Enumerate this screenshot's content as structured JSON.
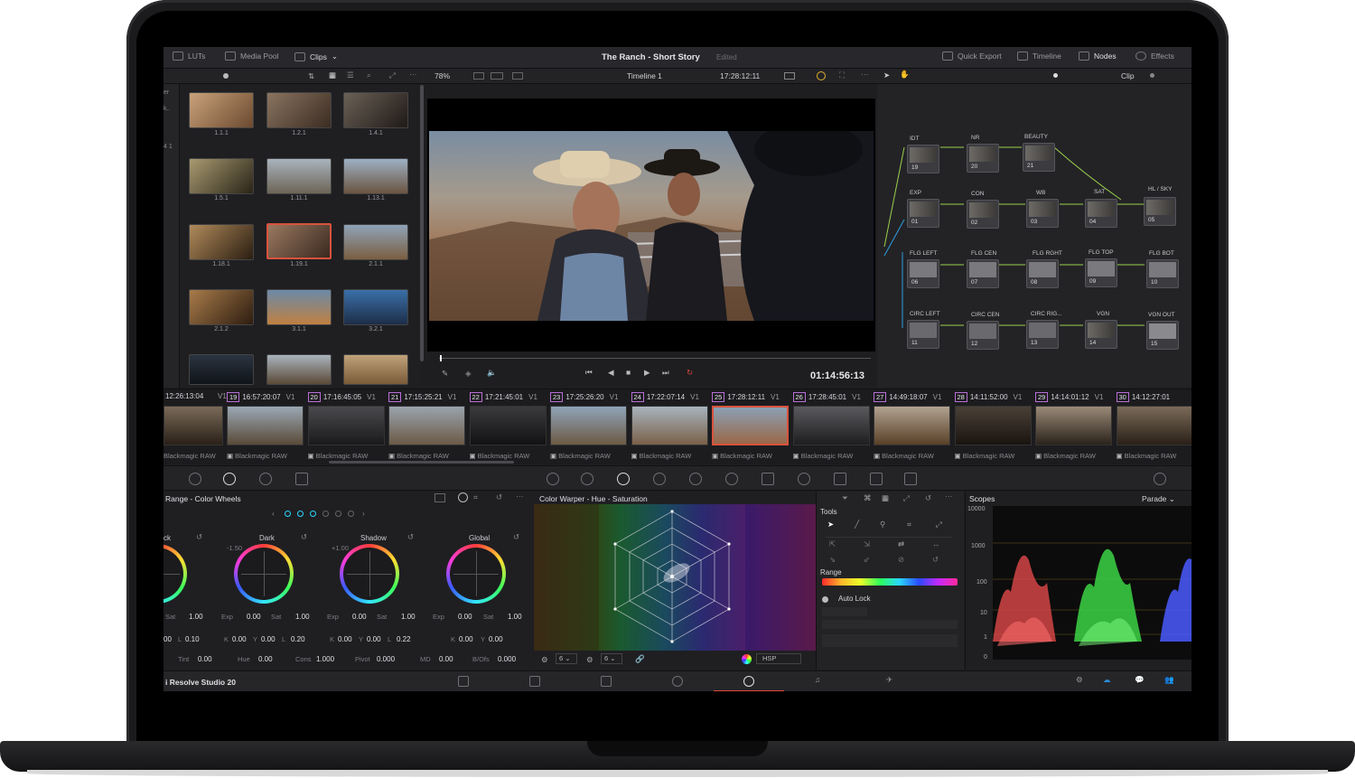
{
  "topbar": {
    "luts": "LUTs",
    "media_pool": "Media Pool",
    "clips": "Clips",
    "project_title": "The Ranch - Short Story",
    "edited": "Edited",
    "quick_export": "Quick Export",
    "timeline": "Timeline",
    "nodes": "Nodes",
    "effects": "Effects"
  },
  "subbar": {
    "zoom": "78%",
    "timeline_name": "Timeline 1",
    "timecode": "17:28:12:11",
    "clip_mode": "Clip"
  },
  "media_pool": {
    "left_labels": [
      "er",
      "k..",
      "4 1"
    ],
    "clips": [
      "1.1.1",
      "1.2.1",
      "1.4.1",
      "1.5.1",
      "1.11.1",
      "1.13.1",
      "1.18.1",
      "1.19.1",
      "2.1.1",
      "2.1.2",
      "3.1.1",
      "3.2.1"
    ]
  },
  "viewer": {
    "timecode": "01:14:56:13"
  },
  "nodes": [
    {
      "label": "IDT",
      "num": "19"
    },
    {
      "label": "NR",
      "num": "20"
    },
    {
      "label": "BEAUTY",
      "num": "21"
    },
    {
      "label": "EXP",
      "num": "01"
    },
    {
      "label": "CON",
      "num": "02"
    },
    {
      "label": "WB",
      "num": "03"
    },
    {
      "label": "SAT",
      "num": "04"
    },
    {
      "label": "HL / SKY",
      "num": "05"
    },
    {
      "label": "FLG LEFT",
      "num": "06"
    },
    {
      "label": "FLG CEN",
      "num": "07"
    },
    {
      "label": "FLG RGHT",
      "num": "08"
    },
    {
      "label": "FLG TOP",
      "num": "09"
    },
    {
      "label": "FLG BOT",
      "num": "10"
    },
    {
      "label": "CIRC LEFT",
      "num": "11"
    },
    {
      "label": "CIRC CEN",
      "num": "12"
    },
    {
      "label": "CIRC RIG...",
      "num": "13"
    },
    {
      "label": "VGN",
      "num": "14"
    },
    {
      "label": "VGN OUT",
      "num": "15"
    }
  ],
  "timeline_strip": {
    "first_tc": "12:26:13:04",
    "track": "V1",
    "codec": "Blackmagic RAW",
    "clips": [
      {
        "num": "19",
        "tc": "16:57:20:07"
      },
      {
        "num": "20",
        "tc": "17:16:45:05"
      },
      {
        "num": "21",
        "tc": "17:15:25:21"
      },
      {
        "num": "22",
        "tc": "17:21:45:01"
      },
      {
        "num": "23",
        "tc": "17:25:26:20"
      },
      {
        "num": "24",
        "tc": "17:22:07:14"
      },
      {
        "num": "25",
        "tc": "17:28:12:11"
      },
      {
        "num": "26",
        "tc": "17:28:45:01"
      },
      {
        "num": "27",
        "tc": "14:49:18:07"
      },
      {
        "num": "28",
        "tc": "14:11:52:00"
      },
      {
        "num": "29",
        "tc": "14:14:01:12"
      },
      {
        "num": "30",
        "tc": "14:12:27:01"
      }
    ]
  },
  "wheels": {
    "title": "Range - Color Wheels",
    "wheel_names": [
      "ck",
      "Dark",
      "Shadow",
      "Global"
    ],
    "dark_offset": "-1.50",
    "shadow_offset": "+1.00",
    "row1_labels": {
      "sat": "Sat",
      "exp": "Exp"
    },
    "row1": {
      "w0_sat": "1.00",
      "dark_exp": "0.00",
      "dark_sat": "1.00",
      "shadow_exp": "0.00",
      "shadow_sat": "1.00",
      "global_exp": "0.00",
      "global_sat": "1.00"
    },
    "row2_keys": {
      "k": "K",
      "y": "Y",
      "l": "L"
    },
    "row2": {
      "w0_a": "00",
      "w0_l": "0.10",
      "dark_k": "0.00",
      "dark_y": "0.00",
      "dark_l": "0.20",
      "shadow_k": "0.00",
      "shadow_y": "0.00",
      "shadow_l": "0.22",
      "global_k": "0.00",
      "global_y": "0.00"
    },
    "params": [
      {
        "key": "Tint",
        "val": "0.00"
      },
      {
        "key": "Hue",
        "val": "0.00"
      },
      {
        "key": "Cons",
        "val": "1.000"
      },
      {
        "key": "Pivot",
        "val": "0.000"
      },
      {
        "key": "MD",
        "val": "0.00"
      },
      {
        "key": "B/Ofs",
        "val": "0.000"
      }
    ]
  },
  "warper": {
    "title": "Color Warper - Hue - Saturation",
    "res_a": "6",
    "res_b": "6",
    "mode": "HSP"
  },
  "tools": {
    "title": "Tools",
    "range": "Range",
    "auto_lock": "Auto Lock"
  },
  "scopes": {
    "title": "Scopes",
    "mode": "Parade",
    "axis": [
      "10000",
      "1000",
      "100",
      "10",
      "1",
      "0"
    ]
  },
  "pagebar": {
    "app_name": "i Resolve Studio 20"
  }
}
